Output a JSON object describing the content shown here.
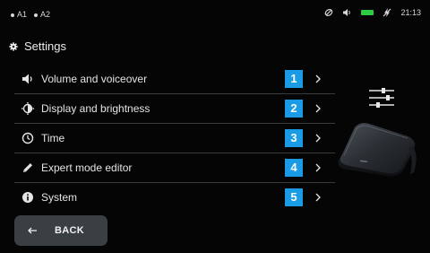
{
  "status": {
    "left_items": [
      {
        "label": "A1"
      },
      {
        "label": "A2"
      }
    ],
    "time": "21:13",
    "battery_color": "#2ecc40"
  },
  "header": {
    "icon": "gear-icon",
    "title": "Settings"
  },
  "menu": {
    "items": [
      {
        "label": "Volume and voiceover",
        "number": "1",
        "icon": "speaker-icon"
      },
      {
        "label": "Display and brightness",
        "number": "2",
        "icon": "brightness-icon"
      },
      {
        "label": "Time",
        "number": "3",
        "icon": "clock-icon"
      },
      {
        "label": "Expert mode editor",
        "number": "4",
        "icon": "pencil-icon"
      },
      {
        "label": "System",
        "number": "5",
        "icon": "info-icon"
      }
    ],
    "badge_color": "#1a9be6"
  },
  "back_button": {
    "label": "BACK",
    "icon": "arrow-left-icon"
  },
  "decor": {
    "icon": "sliders-icon",
    "device": "device-image"
  }
}
